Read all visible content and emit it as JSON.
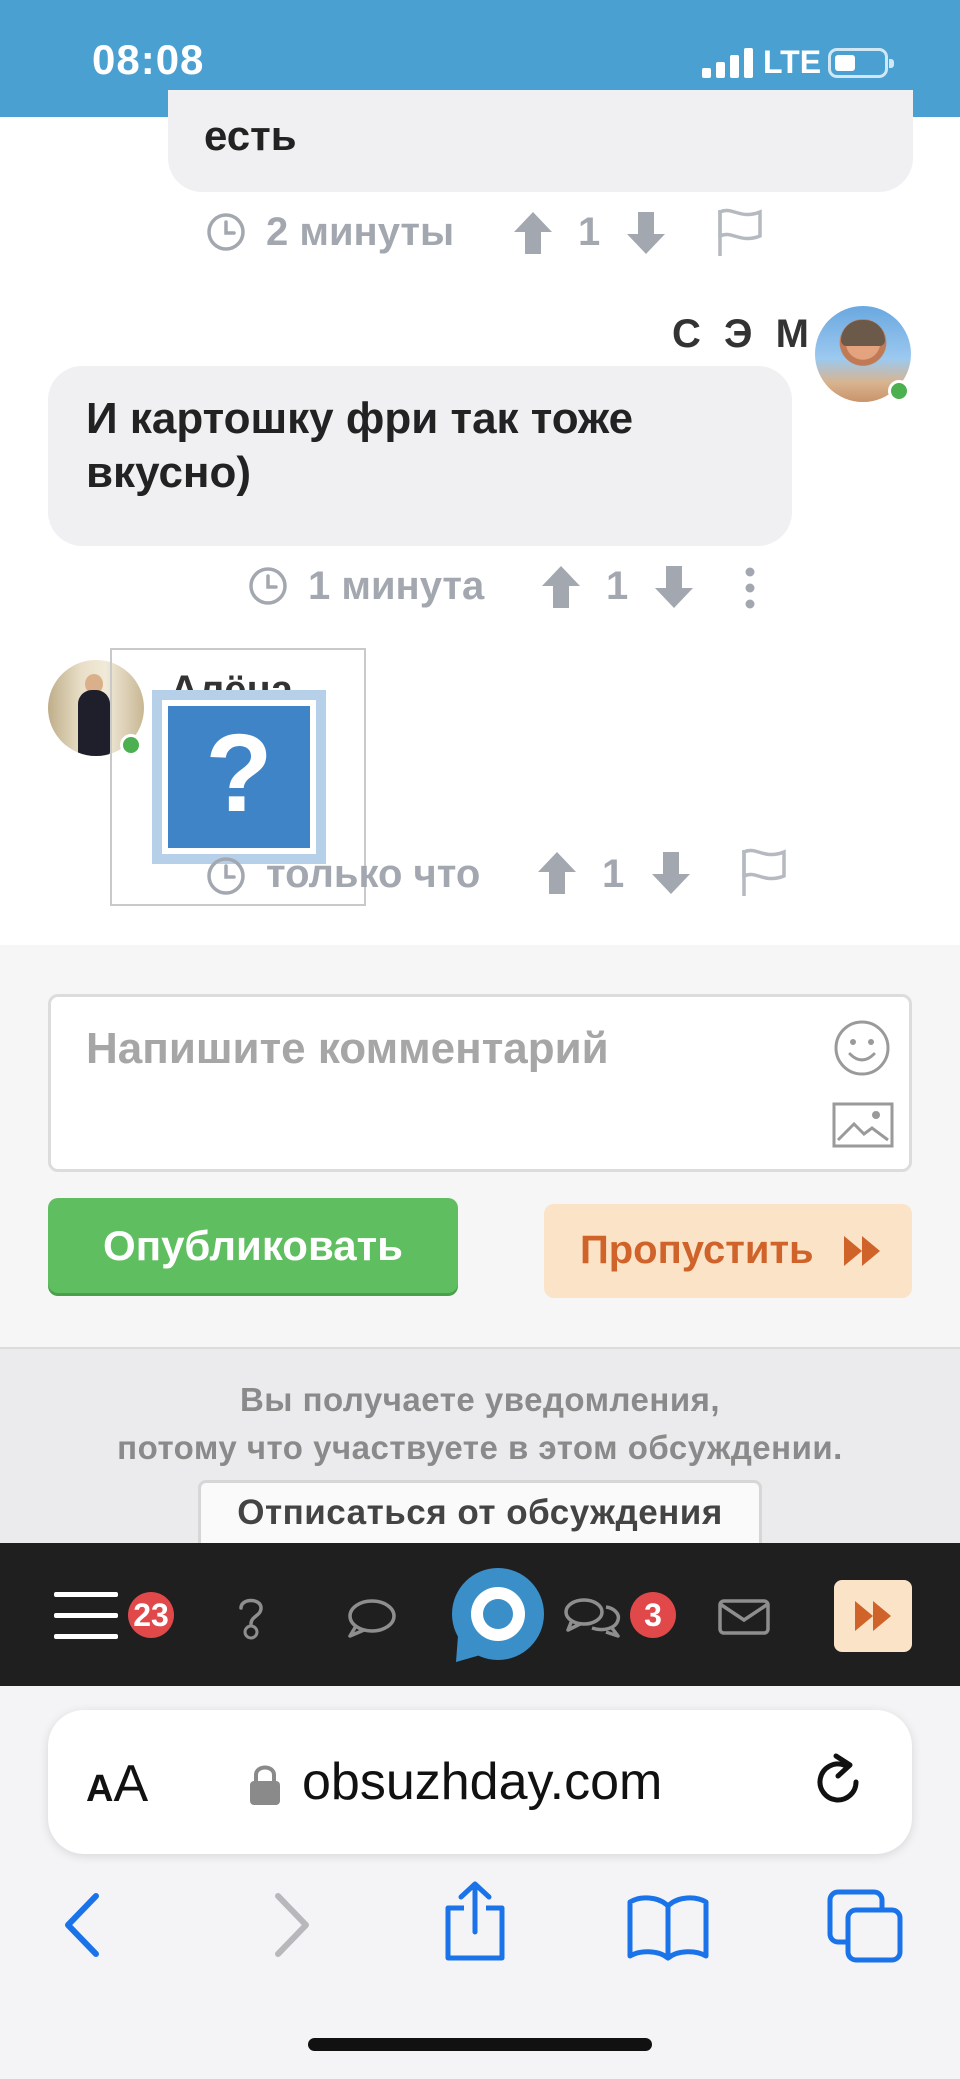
{
  "status_bar": {
    "time": "08:08",
    "network": "LTE"
  },
  "comments": [
    {
      "text": "есть",
      "time": "2 минуты",
      "votes": "1"
    },
    {
      "author": "С Э М",
      "text": "И картошку фри так тоже вкусно)",
      "time": "1 минута",
      "votes": "1"
    },
    {
      "author": "Алёна",
      "time": "только что",
      "votes": "1",
      "image_placeholder": "?"
    }
  ],
  "form": {
    "placeholder": "Напишите комментарий",
    "publish_label": "Опубликовать",
    "skip_label": "Пропустить"
  },
  "notification": {
    "line1": "Вы получаете уведомления,",
    "line2": "потому что участвуете в этом обсуждении.",
    "unsubscribe_label": "Отписаться от обсуждения"
  },
  "site_nav": {
    "menu_badge": "23",
    "chats_badge": "3"
  },
  "browser": {
    "text_size_small": "A",
    "text_size_large": "A",
    "url": "obsuzhday.com"
  },
  "colors": {
    "status_bar": "#4aa0d0",
    "publish": "#5fbe60",
    "skip_bg": "#fbe3c7",
    "skip_text": "#d0632a",
    "badge": "#e0484a",
    "ios_blue": "#1a73e8"
  }
}
